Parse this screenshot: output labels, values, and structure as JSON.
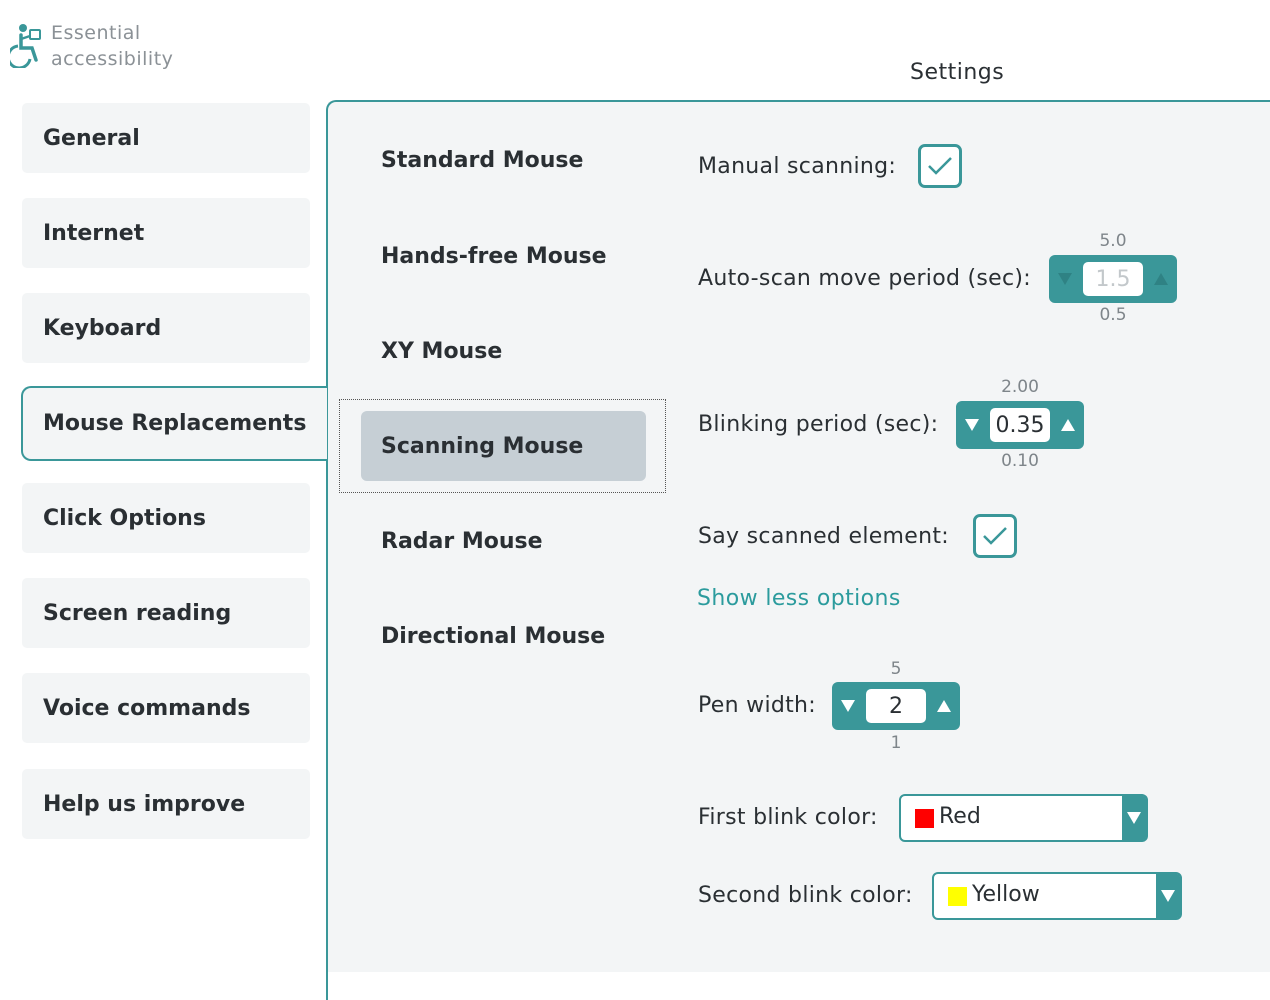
{
  "app": {
    "logo_line1": "Essential",
    "logo_line2": "accessibility",
    "title": "Settings"
  },
  "nav": {
    "items": [
      {
        "label": "General"
      },
      {
        "label": "Internet"
      },
      {
        "label": "Keyboard"
      },
      {
        "label": "Mouse Replacements",
        "active": true
      },
      {
        "label": "Click Options"
      },
      {
        "label": "Screen reading"
      },
      {
        "label": "Voice commands"
      },
      {
        "label": "Help us improve"
      }
    ]
  },
  "subnav": {
    "items": [
      {
        "label": "Standard Mouse"
      },
      {
        "label": "Hands-free Mouse"
      },
      {
        "label": "XY Mouse"
      },
      {
        "label": "Scanning Mouse",
        "active": true
      },
      {
        "label": "Radar Mouse"
      },
      {
        "label": "Directional Mouse"
      }
    ]
  },
  "settings": {
    "manual_scanning": {
      "label": "Manual scanning:",
      "checked": true
    },
    "auto_scan": {
      "label": "Auto-scan move period (sec):",
      "value": "1.5",
      "max": "5.0",
      "min": "0.5",
      "disabled": true
    },
    "blinking": {
      "label": "Blinking period (sec):",
      "value": "0.35",
      "max": "2.00",
      "min": "0.10"
    },
    "say_scanned": {
      "label": "Say scanned element:",
      "checked": true
    },
    "show_less": "Show less options",
    "pen_width": {
      "label": "Pen width:",
      "value": "2",
      "max": "5",
      "min": "1"
    },
    "first_blink": {
      "label": "First blink color:",
      "value": "Red",
      "color": "#ff0000"
    },
    "second_blink": {
      "label": "Second blink color:",
      "value": "Yellow",
      "color": "#ffff00"
    }
  },
  "colors": {
    "accent": "#3a9799",
    "link": "#2b9b9d",
    "panel": "#f3f5f6",
    "selected": "#c6cfd5"
  }
}
